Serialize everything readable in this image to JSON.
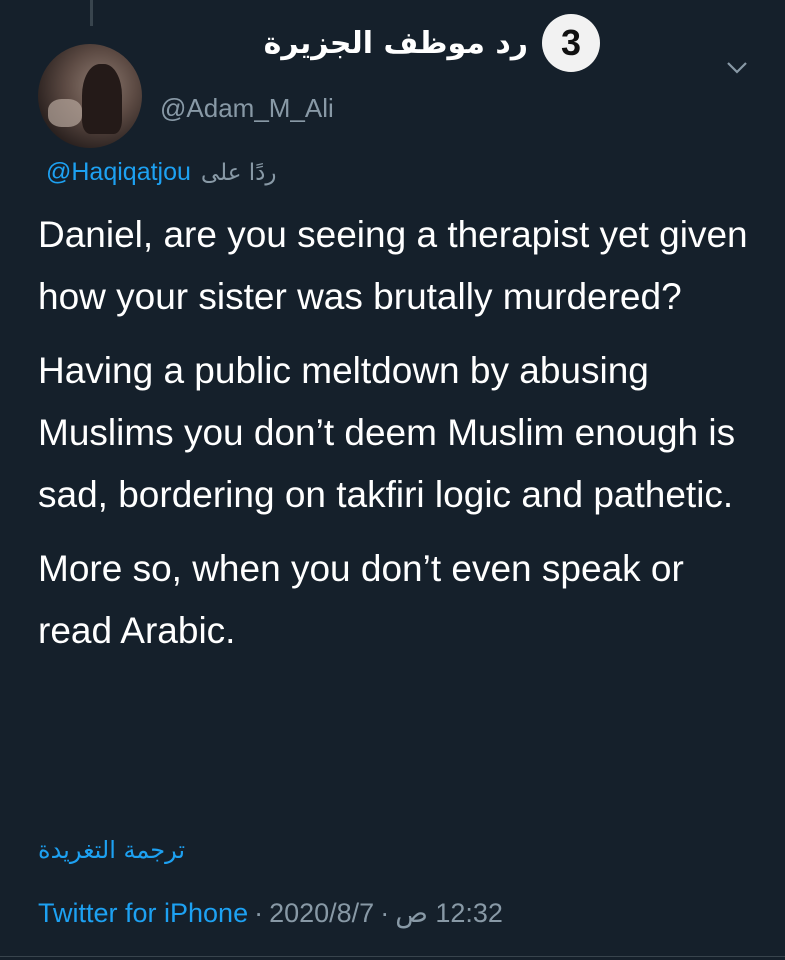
{
  "overlay": {
    "number": "3",
    "title": "رد موظف الجزيرة"
  },
  "user": {
    "handle": "@Adam_M_Ali"
  },
  "reply": {
    "label": "ردًا على",
    "mention": "@Haqiqatjou"
  },
  "tweet": {
    "paragraphs": [
      "Daniel, are you seeing a therapist yet given how your sister was brutally murdered?",
      "Having a public meltdown by abusing Muslims you don’t deem Muslim enough is sad, bordering on takfiri logic and pathetic.",
      "More so, when you don’t even speak or read Arabic."
    ]
  },
  "translate_label": "ترجمة التغريدة",
  "meta": {
    "source": "Twitter for iPhone",
    "separator": "·",
    "date": "2020/8/7",
    "time": "12:32 ص"
  },
  "colors": {
    "background": "#15202b",
    "link": "#1da1f2",
    "muted": "#8899a6"
  },
  "icons": [
    "chevron-down-icon",
    "avatar"
  ]
}
